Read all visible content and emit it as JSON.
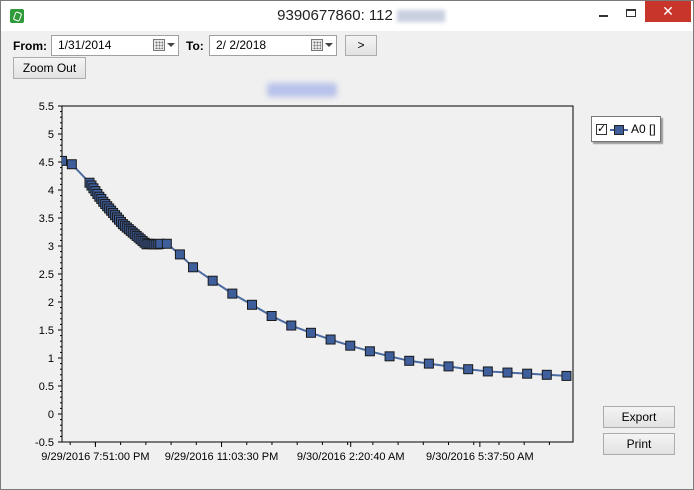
{
  "window": {
    "title": "9390677860: 112",
    "controls": {
      "close": "✕"
    }
  },
  "toolbar": {
    "from_label": "From:",
    "from_date": "1/31/2014",
    "to_label": "To:",
    "to_date": "2/  2/2018",
    "go_label": ">",
    "zoom_out_label": "Zoom Out"
  },
  "side_buttons": {
    "export_label": "Export",
    "print_label": "Print"
  },
  "legend": {
    "checked": true,
    "check_glyph": "✓",
    "series_label": "A0 []"
  },
  "colors": {
    "series_fill": "#3e5e9c",
    "series_line": "#4a6aa0",
    "marker_border": "#1a1a1a",
    "close_button": "#c7352b"
  },
  "chart_data": {
    "type": "line",
    "title": "",
    "xlabel": "",
    "ylabel": "",
    "ylim": [
      -0.5,
      5.5
    ],
    "yticks": [
      -0.5,
      0,
      0.5,
      1,
      1.5,
      2,
      2.5,
      3,
      3.5,
      4,
      4.5,
      5,
      5.5
    ],
    "ytick_labels": [
      "-0.5",
      "0",
      "0.5",
      "1",
      "1.5",
      "2",
      "2.5",
      "3",
      "3.5",
      "4",
      "4.5",
      "5",
      "5.5"
    ],
    "xlim": [
      "9/29/2016 7:00:00 PM",
      "9/30/2016 8:00:00 AM"
    ],
    "xticks": [
      "9/29/2016 7:51:00 PM",
      "9/29/2016 11:03:30 PM",
      "9/30/2016 2:20:40 AM",
      "9/30/2016 5:37:50 AM"
    ],
    "xtick_labels": [
      "9/29/2016 7:51:00 PM",
      "9/29/2016 11:03:30 PM",
      "9/30/2016 2:20:40 AM",
      "9/30/2016 5:37:50 AM"
    ],
    "grid": false,
    "legend_position": "top-right",
    "series": [
      {
        "name": "A0 []",
        "x": [
          "9/29/2016 7:00:00 PM",
          "9/29/2016 7:15:00 PM",
          "9/29/2016 7:42:00 PM",
          "9/29/2016 7:45:00 PM",
          "9/29/2016 7:48:00 PM",
          "9/29/2016 7:51:00 PM",
          "9/29/2016 7:54:00 PM",
          "9/29/2016 7:57:00 PM",
          "9/29/2016 8:00:00 PM",
          "9/29/2016 8:03:00 PM",
          "9/29/2016 8:06:00 PM",
          "9/29/2016 8:09:00 PM",
          "9/29/2016 8:12:00 PM",
          "9/29/2016 8:15:00 PM",
          "9/29/2016 8:18:00 PM",
          "9/29/2016 8:21:00 PM",
          "9/29/2016 8:24:00 PM",
          "9/29/2016 8:27:00 PM",
          "9/29/2016 8:30:00 PM",
          "9/29/2016 8:33:00 PM",
          "9/29/2016 8:36:00 PM",
          "9/29/2016 8:39:00 PM",
          "9/29/2016 8:42:00 PM",
          "9/29/2016 8:45:00 PM",
          "9/29/2016 8:48:00 PM",
          "9/29/2016 8:51:00 PM",
          "9/29/2016 8:54:00 PM",
          "9/29/2016 8:57:00 PM",
          "9/29/2016 9:00:00 PM",
          "9/29/2016 9:03:00 PM",
          "9/29/2016 9:06:00 PM",
          "9/29/2016 9:09:00 PM",
          "9/29/2016 9:12:00 PM",
          "9/29/2016 9:15:00 PM",
          "9/29/2016 9:18:00 PM",
          "9/29/2016 9:21:00 PM",
          "9/29/2016 9:24:00 PM",
          "9/29/2016 9:27:00 PM",
          "9/29/2016 9:30:00 PM",
          "9/29/2016 9:40:00 PM",
          "9/29/2016 10:00:00 PM",
          "9/29/2016 10:20:00 PM",
          "9/29/2016 10:50:00 PM",
          "9/29/2016 11:20:00 PM",
          "9/29/2016 11:50:00 PM",
          "9/30/2016 12:20:00 AM",
          "9/30/2016 12:50:00 AM",
          "9/30/2016 1:20:00 AM",
          "9/30/2016 1:50:00 AM",
          "9/30/2016 2:20:00 AM",
          "9/30/2016 2:50:00 AM",
          "9/30/2016 3:20:00 AM",
          "9/30/2016 3:50:00 AM",
          "9/30/2016 4:20:00 AM",
          "9/30/2016 4:50:00 AM",
          "9/30/2016 5:20:00 AM",
          "9/30/2016 5:50:00 AM",
          "9/30/2016 6:20:00 AM",
          "9/30/2016 6:50:00 AM",
          "9/30/2016 7:20:00 AM",
          "9/30/2016 7:50:00 AM"
        ],
        "y": [
          4.52,
          4.46,
          4.13,
          4.08,
          4.03,
          3.98,
          3.93,
          3.88,
          3.84,
          3.79,
          3.75,
          3.71,
          3.67,
          3.63,
          3.59,
          3.55,
          3.51,
          3.47,
          3.43,
          3.39,
          3.36,
          3.33,
          3.3,
          3.27,
          3.24,
          3.21,
          3.18,
          3.15,
          3.12,
          3.09,
          3.06,
          3.03,
          3.04,
          3.04,
          3.03,
          3.03,
          3.03,
          3.03,
          3.04,
          3.04,
          2.85,
          2.62,
          2.38,
          2.15,
          1.95,
          1.75,
          1.58,
          1.45,
          1.33,
          1.22,
          1.12,
          1.03,
          0.95,
          0.9,
          0.85,
          0.8,
          0.76,
          0.74,
          0.72,
          0.7,
          0.68
        ]
      }
    ]
  }
}
